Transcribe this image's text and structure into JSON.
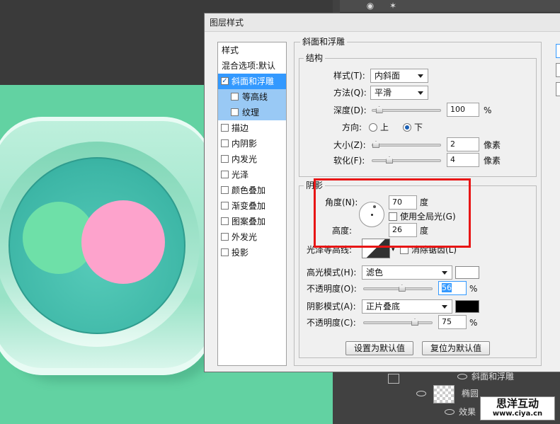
{
  "dialog": {
    "title": "图层样式"
  },
  "style_list": {
    "header": "样式",
    "blend_default": "混合选项:默认",
    "items": [
      {
        "label": "斜面和浮雕",
        "checked": true
      },
      {
        "label": "等高线",
        "checked": false
      },
      {
        "label": "纹理",
        "checked": false
      },
      {
        "label": "描边",
        "checked": false
      },
      {
        "label": "内阴影",
        "checked": false
      },
      {
        "label": "内发光",
        "checked": false
      },
      {
        "label": "光泽",
        "checked": false
      },
      {
        "label": "颜色叠加",
        "checked": false
      },
      {
        "label": "渐变叠加",
        "checked": false
      },
      {
        "label": "图案叠加",
        "checked": false
      },
      {
        "label": "外发光",
        "checked": false
      },
      {
        "label": "投影",
        "checked": false
      }
    ]
  },
  "bevel": {
    "group_title": "斜面和浮雕",
    "structure_title": "结构",
    "style_label": "样式(T):",
    "style_value": "内斜面",
    "technique_label": "方法(Q):",
    "technique_value": "平滑",
    "depth_label": "深度(D):",
    "depth_value": "100",
    "depth_unit": "%",
    "depth_level": 0.1,
    "direction_label": "方向:",
    "direction_up": "上",
    "direction_down": "下",
    "direction_selected": "下",
    "size_label": "大小(Z):",
    "size_value": "2",
    "size_unit": "像素",
    "size_level": 0.02,
    "soften_label": "软化(F):",
    "soften_value": "4",
    "soften_unit": "像素",
    "soften_level": 0.25
  },
  "shading": {
    "title": "阴影",
    "angle_label": "角度(N):",
    "angle_value": "70",
    "angle_unit": "度",
    "global_light_label": "使用全局光(G)",
    "global_light_checked": false,
    "altitude_label": "高度:",
    "altitude_value": "26",
    "altitude_unit": "度",
    "gloss_label": "光泽等高线:",
    "antialias_label": "消除锯齿(L)",
    "antialias_checked": false,
    "highlight_mode_label": "高光模式(H):",
    "highlight_mode_value": "滤色",
    "highlight_color": "#ffffff",
    "highlight_opacity_label": "不透明度(O):",
    "highlight_opacity_value": "56",
    "highlight_opacity_level": 0.56,
    "shadow_mode_label": "阴影模式(A):",
    "shadow_mode_value": "正片叠底",
    "shadow_color": "#000000",
    "shadow_opacity_label": "不透明度(C):",
    "shadow_opacity_value": "75",
    "shadow_opacity_level": 0.75,
    "percent": "%"
  },
  "buttons": {
    "set_default": "设置为默认值",
    "reset_default": "复位为默认值"
  },
  "layers": {
    "effect_bevel": "斜面和浮雕",
    "layer_name": "椭圆",
    "effects": "效果",
    "effect_bevel2": "斜面和浮雕"
  },
  "watermark": {
    "text": "思洋互动",
    "url": "www.ciya.cn"
  },
  "colors": {
    "canvas_green": "#62d2a2",
    "pink": "#fda3cc",
    "mint": "#6ee0a8",
    "selection": "#3399ff",
    "annotation_red": "#e81515"
  }
}
